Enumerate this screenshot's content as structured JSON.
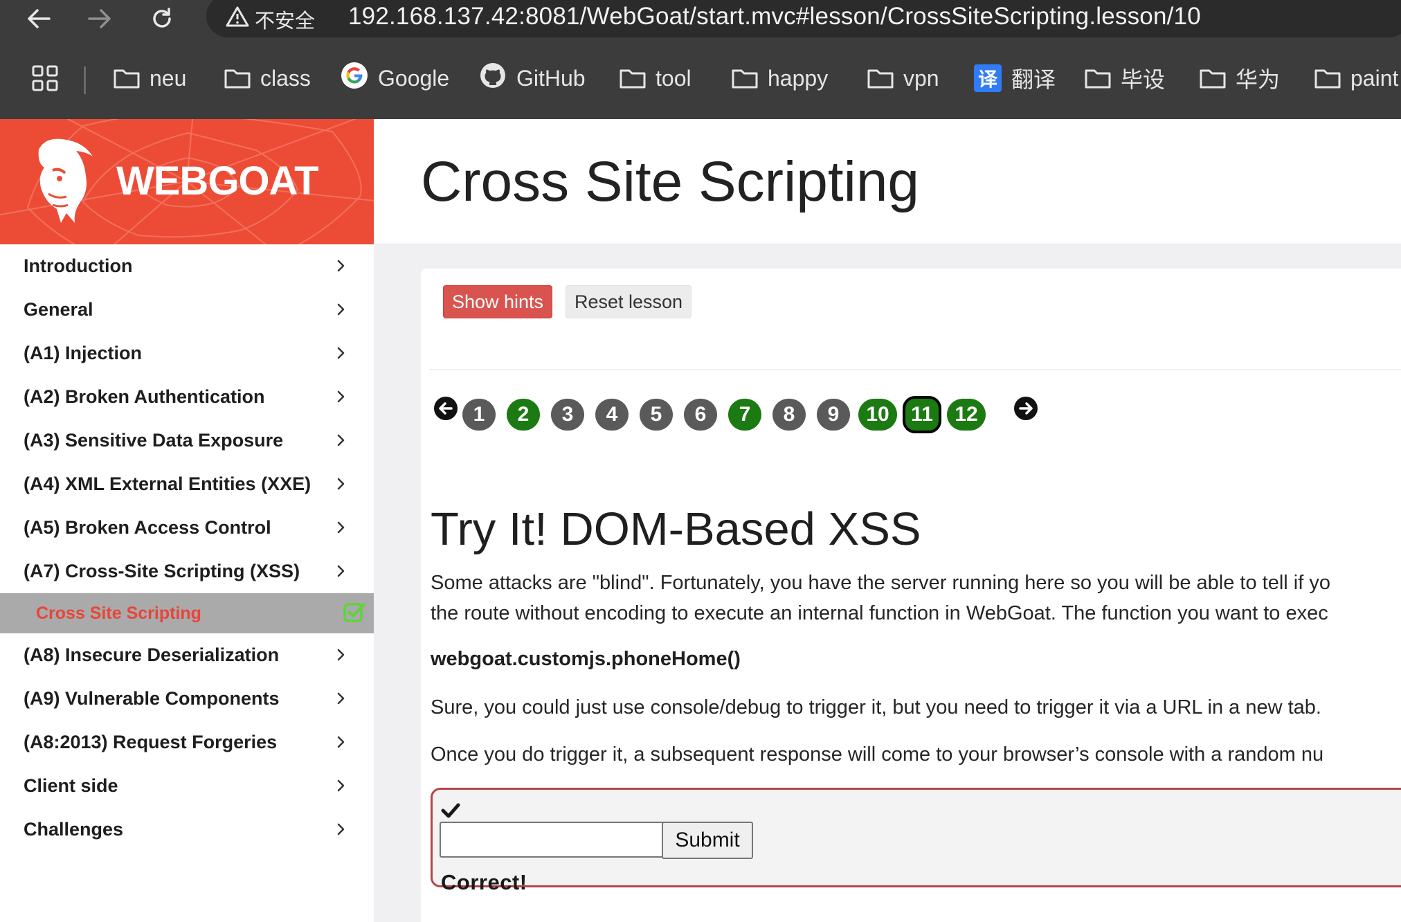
{
  "browser": {
    "security_label": "不安全",
    "url": "192.168.137.42:8081/WebGoat/start.mvc#lesson/CrossSiteScripting.lesson/10",
    "bookmarks": [
      {
        "label": "neu",
        "icon": "folder-icon"
      },
      {
        "label": "class",
        "icon": "folder-icon"
      },
      {
        "label": "Google",
        "icon": "google-icon"
      },
      {
        "label": "GitHub",
        "icon": "github-icon"
      },
      {
        "label": "tool",
        "icon": "folder-icon"
      },
      {
        "label": "happy",
        "icon": "folder-icon"
      },
      {
        "label": "vpn",
        "icon": "folder-icon"
      },
      {
        "label": "翻译",
        "icon": "translate-icon"
      },
      {
        "label": "毕设",
        "icon": "folder-icon"
      },
      {
        "label": "华为",
        "icon": "folder-icon"
      },
      {
        "label": "paint",
        "icon": "folder-icon"
      }
    ],
    "translate_glyph": "译"
  },
  "logo": {
    "text": "WEBGOAT"
  },
  "sidebar": {
    "items": [
      {
        "label": "Introduction"
      },
      {
        "label": "General"
      },
      {
        "label": "(A1) Injection"
      },
      {
        "label": "(A2) Broken Authentication"
      },
      {
        "label": "(A3) Sensitive Data Exposure"
      },
      {
        "label": "(A4) XML External Entities (XXE)"
      },
      {
        "label": "(A5) Broken Access Control"
      },
      {
        "label": "(A7) Cross-Site Scripting (XSS)"
      },
      {
        "label": "(A8) Insecure Deserialization"
      },
      {
        "label": "(A9) Vulnerable Components"
      },
      {
        "label": "(A8:2013) Request Forgeries"
      },
      {
        "label": "Client side"
      },
      {
        "label": "Challenges"
      }
    ],
    "active_sub": {
      "label": "Cross Site Scripting",
      "completed": true
    }
  },
  "header": {
    "title": "Cross Site Scripting"
  },
  "toolbar": {
    "show_hints": "Show hints",
    "reset_lesson": "Reset lesson"
  },
  "pagination": {
    "pages": [
      {
        "label": "1",
        "status": "gray"
      },
      {
        "label": "2",
        "status": "green"
      },
      {
        "label": "3",
        "status": "gray"
      },
      {
        "label": "4",
        "status": "gray"
      },
      {
        "label": "5",
        "status": "gray"
      },
      {
        "label": "6",
        "status": "gray"
      },
      {
        "label": "7",
        "status": "green"
      },
      {
        "label": "8",
        "status": "gray"
      },
      {
        "label": "9",
        "status": "gray"
      },
      {
        "label": "10",
        "status": "green"
      },
      {
        "label": "11",
        "status": "green",
        "current": true
      },
      {
        "label": "12",
        "status": "green"
      }
    ]
  },
  "lesson": {
    "title": "Try It! DOM-Based XSS",
    "para1_line1": "Some attacks are \"blind\". Fortunately, you have the server running here so you will be able to tell if yo",
    "para1_line2": "the route without encoding to execute an internal function in WebGoat. The function you want to exec",
    "function_name": "webgoat.customjs.phoneHome()",
    "para2": "Sure, you could just use console/debug to trigger it, but you need to trigger it via a URL in a new tab.",
    "para3": "Once you do trigger it, a subsequent response will come to your browser’s console with a random nu"
  },
  "form": {
    "input_value": "",
    "submit_label": "Submit",
    "feedback": "Correct!"
  },
  "colors": {
    "brand": "#ec4c36",
    "completed_green": "#1b7a12",
    "pending_gray": "#5a5a5a",
    "hint_red": "#d9534f",
    "active_sub_text": "#e8453a"
  }
}
